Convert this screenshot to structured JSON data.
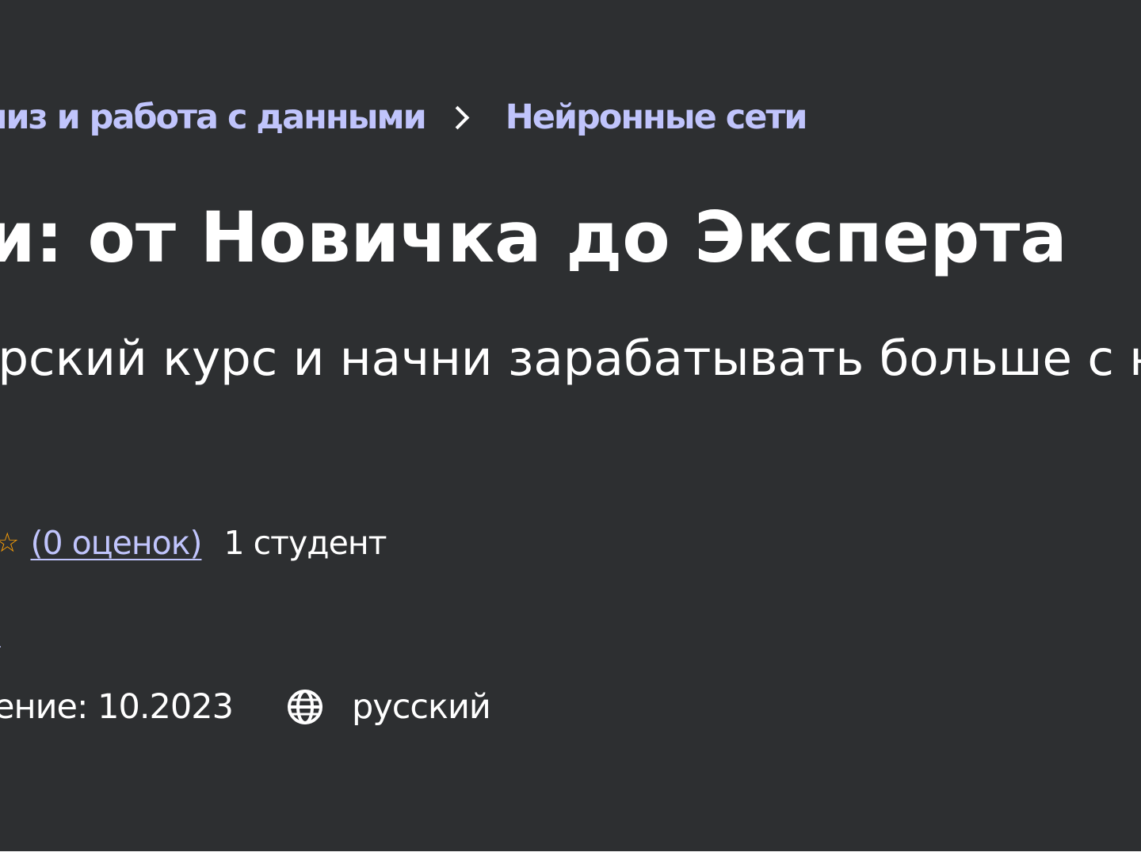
{
  "breadcrumb": {
    "items": [
      {
        "label": "лиз и работа с данными"
      },
      {
        "label": "Нейронные сети"
      }
    ]
  },
  "course": {
    "title": "ти: от Новичка до Эксперта",
    "subtitle": "орский курс и начни зарабатывать больше с не",
    "rating_icon": "star-icon",
    "ratings_link": "(0 оценок)",
    "students": "1 студент",
    "author_fragment": "к",
    "updated": "ение: 10.2023",
    "language_icon": "globe-icon",
    "language": "русский"
  },
  "colors": {
    "background": "#2d2f31",
    "link": "#c0c4fc",
    "text": "#ffffff",
    "star": "#f69c08"
  }
}
